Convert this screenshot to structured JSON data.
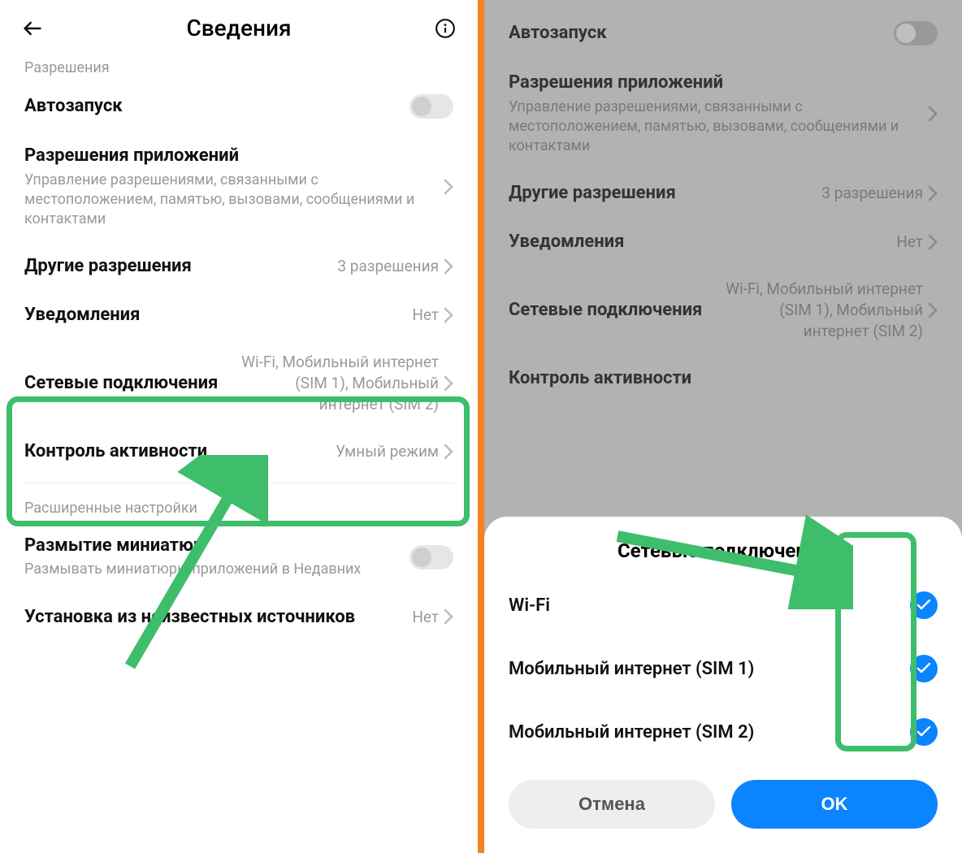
{
  "left": {
    "title": "Сведения",
    "section_permissions": "Разрешения",
    "autostart": "Автозапуск",
    "app_perms": {
      "title": "Разрешения приложений",
      "sub": "Управление разрешениями, связанными с местоположением, памятью, вызовами, сообщениями и контактами"
    },
    "other_perms": {
      "title": "Другие разрешения",
      "value": "3 разрешения"
    },
    "notifications": {
      "title": "Уведомления",
      "value": "Нет"
    },
    "network": {
      "title": "Сетевые подключения",
      "value": "Wi-Fi, Мобильный интернет (SIM 1), Мобильный интернет (SIM 2)"
    },
    "activity": {
      "title": "Контроль активности",
      "value": "Умный режим"
    },
    "section_advanced": "Расширенные настройки",
    "blur": {
      "title": "Размытие миниатюр",
      "sub": "Размывать миниатюры приложений в Недавних"
    },
    "unknown": {
      "title": "Установка из неизвестных источников",
      "value": "Нет"
    }
  },
  "right": {
    "autostart": "Автозапуск",
    "app_perms": {
      "title": "Разрешения приложений",
      "sub": "Управление разрешениями, связанными с местоположением, памятью, вызовами, сообщениями и контактами"
    },
    "other_perms": {
      "title": "Другие разрешения",
      "value": "3 разрешения"
    },
    "notifications": {
      "title": "Уведомления",
      "value": "Нет"
    },
    "network": {
      "title": "Сетевые подключения",
      "value": "Wi-Fi, Мобильный интернет (SIM 1), Мобильный интернет (SIM 2)"
    },
    "activity": {
      "title": "Контроль активности"
    },
    "sheet": {
      "title": "Сетевые подключения",
      "options": [
        "Wi-Fi",
        "Мобильный интернет (SIM 1)",
        "Мобильный интернет (SIM 2)"
      ],
      "cancel": "Отмена",
      "ok": "OK"
    }
  }
}
